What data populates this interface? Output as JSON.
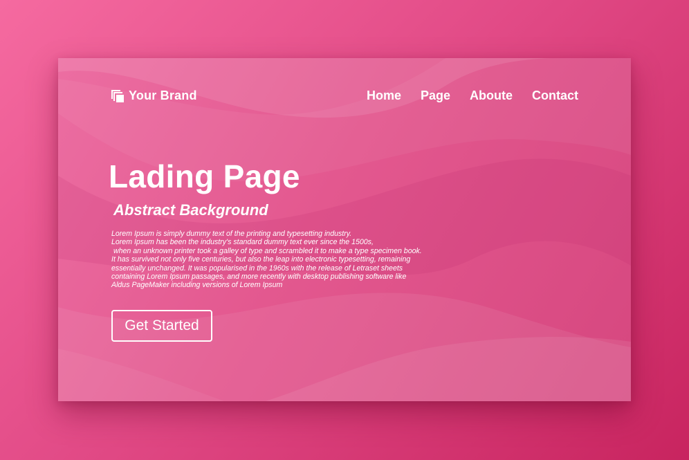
{
  "brand": {
    "name": "Your Brand",
    "icon": "stacked-squares-icon"
  },
  "nav": {
    "items": [
      "Home",
      "Page",
      "Aboute",
      "Contact"
    ]
  },
  "hero": {
    "title": "Lading Page",
    "subtitle": "Abstract Background",
    "body_lines": [
      "Lorem Ipsum is simply dummy text of the printing and typesetting industry.",
      "Lorem Ipsum has been the industry's standard dummy text ever since the 1500s,",
      " when an unknown printer took a galley of type and scrambled it to make a type specimen book.",
      "It has survived not only five centuries, but also the leap into electronic typesetting, remaining",
      "essentially unchanged. It was popularised in the 1960s with the release of Letraset sheets",
      "containing Lorem Ipsum passages, and more recently with desktop publishing software like",
      "Aldus PageMaker including versions of Lorem Ipsum"
    ],
    "cta_label": "Get Started"
  },
  "colors": {
    "background_start": "#f56aa0",
    "background_end": "#c8245f",
    "card": "#e3588f",
    "text": "#ffffff"
  }
}
